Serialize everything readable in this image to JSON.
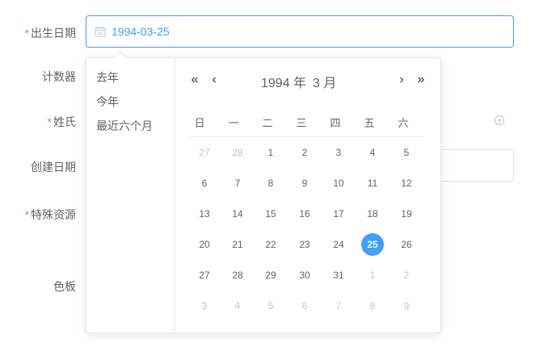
{
  "form": {
    "birth_label": "出生日期",
    "birth_value": "1994-03-25",
    "counter_label": "计数器",
    "surname_label": "姓氏",
    "created_label": "创建日期",
    "resource_label": "特殊资源",
    "palette_label": "色板",
    "required_mark": "*"
  },
  "picker": {
    "shortcuts": [
      "去年",
      "今年",
      "最近六个月"
    ],
    "year_label": "1994 年",
    "month_label": "3 月",
    "nav": {
      "prev_year": "«",
      "prev_month": "‹",
      "next_month": "›",
      "next_year": "»"
    },
    "weekdays": [
      "日",
      "一",
      "二",
      "三",
      "四",
      "五",
      "六"
    ],
    "weeks": [
      [
        {
          "d": "27",
          "o": 1
        },
        {
          "d": "28",
          "o": 1
        },
        {
          "d": "1"
        },
        {
          "d": "2"
        },
        {
          "d": "3"
        },
        {
          "d": "4"
        },
        {
          "d": "5"
        }
      ],
      [
        {
          "d": "6"
        },
        {
          "d": "7"
        },
        {
          "d": "8"
        },
        {
          "d": "9"
        },
        {
          "d": "10"
        },
        {
          "d": "11"
        },
        {
          "d": "12"
        }
      ],
      [
        {
          "d": "13"
        },
        {
          "d": "14"
        },
        {
          "d": "15"
        },
        {
          "d": "16"
        },
        {
          "d": "17"
        },
        {
          "d": "18"
        },
        {
          "d": "19"
        }
      ],
      [
        {
          "d": "20"
        },
        {
          "d": "21"
        },
        {
          "d": "22"
        },
        {
          "d": "23"
        },
        {
          "d": "24"
        },
        {
          "d": "25",
          "s": 1
        },
        {
          "d": "26"
        }
      ],
      [
        {
          "d": "27"
        },
        {
          "d": "28"
        },
        {
          "d": "29"
        },
        {
          "d": "30"
        },
        {
          "d": "31"
        },
        {
          "d": "1",
          "o": 1
        },
        {
          "d": "2",
          "o": 1
        }
      ],
      [
        {
          "d": "3",
          "o": 1
        },
        {
          "d": "4",
          "o": 1
        },
        {
          "d": "5",
          "o": 1
        },
        {
          "d": "6",
          "o": 1
        },
        {
          "d": "7",
          "o": 1
        },
        {
          "d": "8",
          "o": 1
        },
        {
          "d": "9",
          "o": 1
        }
      ]
    ]
  },
  "colors": {
    "accent": "#409eff",
    "required": "#f56c6c",
    "text": "#606266",
    "muted": "#c0c4cc"
  }
}
